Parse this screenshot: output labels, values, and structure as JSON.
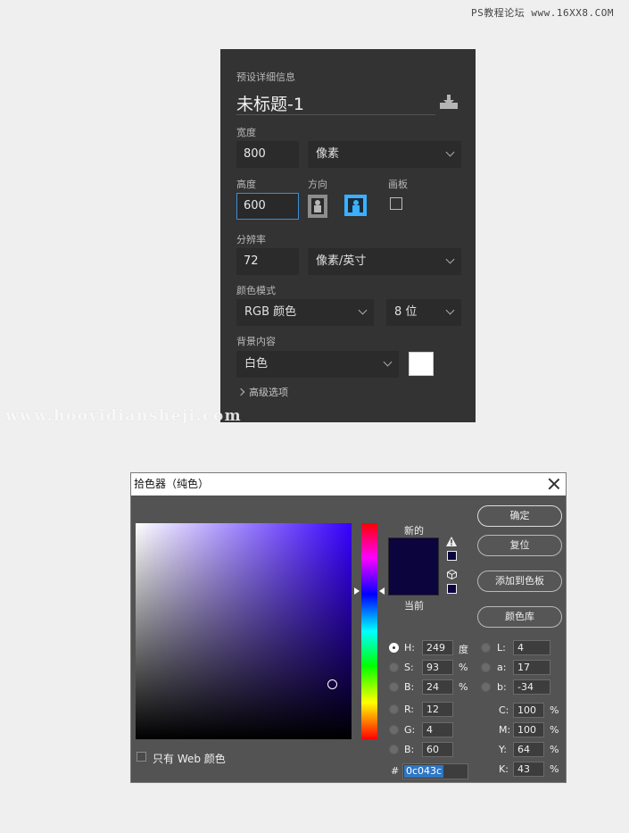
{
  "watermarks": {
    "top": "PS教程论坛 www.16XX8.COM",
    "mid": "www.hooyidiansheji.com"
  },
  "preset": {
    "section_title": "预设详细信息",
    "doc_name": "未标题-1",
    "width_label": "宽度",
    "width_value": "800",
    "width_unit": "像素",
    "height_label": "高度",
    "height_value": "600",
    "orientation_label": "方向",
    "artboard_label": "画板",
    "resolution_label": "分辨率",
    "resolution_value": "72",
    "resolution_unit": "像素/英寸",
    "color_mode_label": "颜色模式",
    "color_mode_value": "RGB 颜色",
    "bit_depth_value": "8 位",
    "background_label": "背景内容",
    "background_value": "白色",
    "background_color": "#ffffff",
    "advanced_label": "高级选项"
  },
  "picker": {
    "title": "拾色器（纯色）",
    "new_label": "新的",
    "current_label": "当前",
    "new_color": "#0c043c",
    "buttons": {
      "ok": "确定",
      "reset": "复位",
      "add_swatch": "添加到色板",
      "library": "颜色库"
    },
    "hsb": {
      "h_label": "H:",
      "h_value": "249",
      "h_unit": "度",
      "s_label": "S:",
      "s_value": "93",
      "s_unit": "%",
      "b_label": "B:",
      "b_value": "24",
      "b_unit": "%"
    },
    "rgb": {
      "r_label": "R:",
      "r_value": "12",
      "g_label": "G:",
      "g_value": "4",
      "b_label": "B:",
      "b_value": "60"
    },
    "lab": {
      "l_label": "L:",
      "l_value": "4",
      "a_label": "a:",
      "a_value": "17",
      "b_label": "b:",
      "b_value": "-34"
    },
    "cmyk": {
      "c_label": "C:",
      "c_value": "100",
      "m_label": "M:",
      "m_value": "100",
      "y_label": "Y:",
      "y_value": "64",
      "k_label": "K:",
      "k_value": "43",
      "unit": "%"
    },
    "hex_label": "#",
    "hex_value": "0c043c",
    "web_only_label": "只有 Web 颜色"
  }
}
